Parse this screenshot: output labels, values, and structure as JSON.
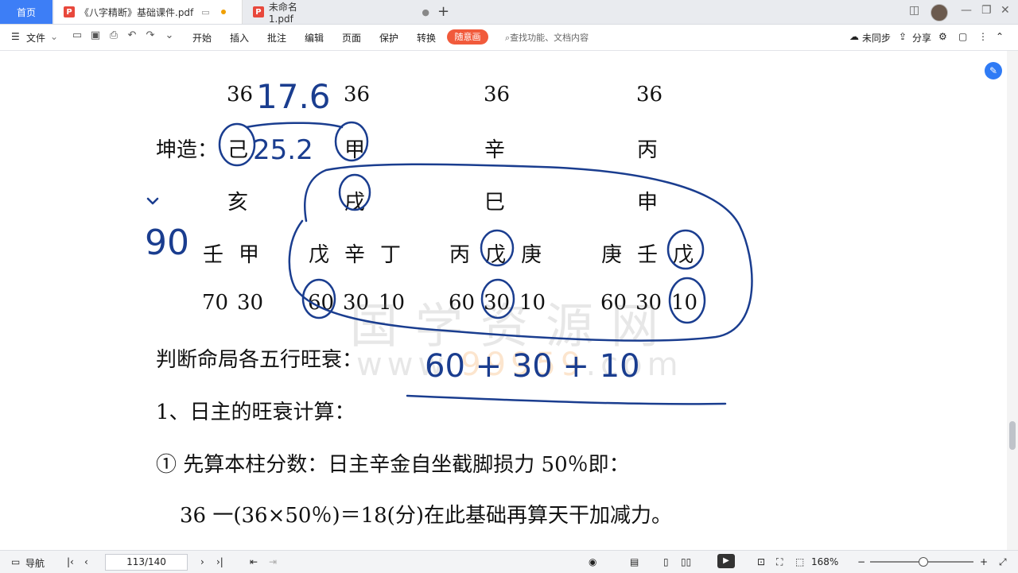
{
  "tabs": {
    "home": "首页",
    "doc1": "《八字精断》基础课件.pdf",
    "doc2": "未命名1.pdf"
  },
  "toolbar": {
    "file": "文件",
    "menu": [
      "开始",
      "插入",
      "批注",
      "编辑",
      "页面",
      "保护",
      "转换"
    ],
    "highlight": "随意画",
    "search": "查找功能、文档内容",
    "sync": "未同步",
    "share": "分享"
  },
  "doc": {
    "row0": [
      "36",
      "36",
      "36",
      "36"
    ],
    "row1_label": "坤造：",
    "row1": [
      "己",
      "甲",
      "辛",
      "丙"
    ],
    "row2": [
      "亥",
      "戌",
      "巳",
      "申"
    ],
    "row3": [
      "壬",
      "甲",
      "戊",
      "辛",
      "丁",
      "丙",
      "戊",
      "庚",
      "庚",
      "壬",
      "戊"
    ],
    "row4": [
      "70",
      "30",
      "60",
      "30",
      "10",
      "60",
      "30",
      "10",
      "60",
      "30",
      "10"
    ],
    "line_judge": "判断命局各五行旺衰：",
    "line_1": "1、日主的旺衰计算：",
    "line_2": "①  先算本柱分数：日主辛金自坐截脚损力 50％即：",
    "line_3": "36 一(36×50％)＝18(分)在此基础再算天干加减力。",
    "watermark_cn": "国学资源网",
    "watermark_url": "www.99959.com",
    "handwritten": [
      "17.6",
      "25.2",
      "90",
      "60 + 30 + 10"
    ]
  },
  "status": {
    "nav": "导航",
    "page": "113/140",
    "zoom": "168%"
  }
}
